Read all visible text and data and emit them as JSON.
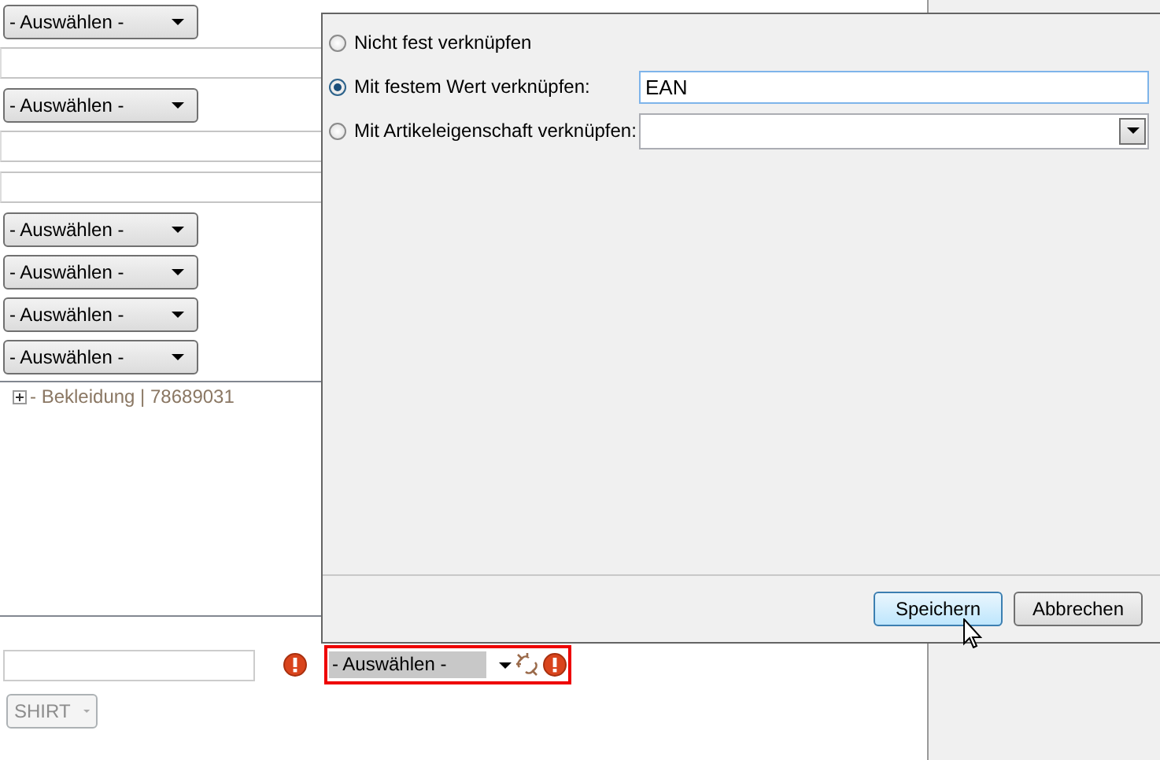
{
  "form": {
    "rows": [
      {
        "kind": "select",
        "value": "- Auswählen -"
      },
      {
        "kind": "field"
      },
      {
        "kind": "select",
        "value": "- Auswählen -"
      },
      {
        "kind": "field"
      },
      {
        "kind": "field"
      },
      {
        "kind": "select",
        "value": "- Auswählen -"
      },
      {
        "kind": "select",
        "value": "- Auswählen -"
      },
      {
        "kind": "select",
        "value": "- Auswählen -"
      },
      {
        "kind": "select",
        "value": "- Auswählen -"
      }
    ],
    "tree": {
      "items": [
        {
          "label": "- Bekleidung | 78689031",
          "expanded": false
        }
      ]
    },
    "linked_select": {
      "value": "- Auswählen -",
      "invalid": true
    },
    "size_select": {
      "value": "SHIRT",
      "disabled": true
    }
  },
  "dialog": {
    "options": [
      {
        "label": "Nicht fest verknüpfen",
        "selected": false,
        "kind": "none"
      },
      {
        "label": "Mit festem Wert verknüpfen:",
        "selected": true,
        "kind": "text",
        "value": "EAN"
      },
      {
        "label": "Mit Artikeleigenschaft verknüpfen:",
        "selected": false,
        "kind": "dropdown"
      }
    ],
    "buttons": [
      {
        "label": "Speichern",
        "hovered": true
      },
      {
        "label": "Abbrechen",
        "hovered": false
      }
    ]
  }
}
